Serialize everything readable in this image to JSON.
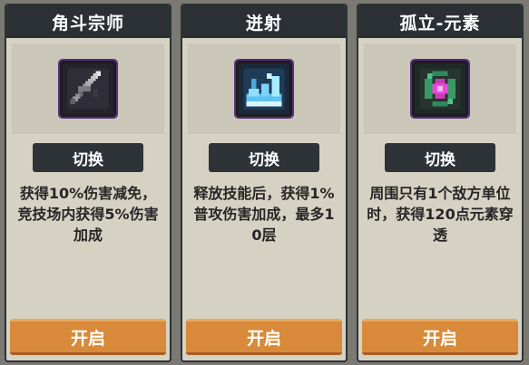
{
  "switch_label": "切换",
  "open_label": "开启",
  "cards": [
    {
      "title": "角斗宗师",
      "icon": "sword-icon",
      "description": "获得10%伤害减免，竞技场内获得5%伤害加成"
    },
    {
      "title": "迸射",
      "icon": "burst-icon",
      "description": "释放技能后，获得1%普攻伤害加成，最多10层"
    },
    {
      "title": "孤立-元素",
      "icon": "element-orb-icon",
      "description": "周围只有1个敌方单位时，获得120点元素穿透"
    }
  ],
  "colors": {
    "title_bar": "#2b3035",
    "panel": "#d6d2c3",
    "open_button": "#d88a3a",
    "icon_border": "#5a2b7a"
  }
}
